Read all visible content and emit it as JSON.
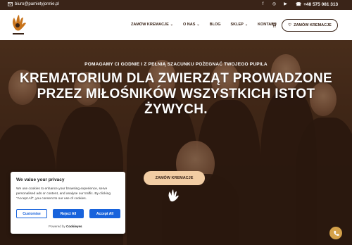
{
  "topbar": {
    "email": "biuro@pamietyjonnie.pl",
    "phone": "+48 575 081 313",
    "socials": [
      "facebook-icon",
      "instagram-icon",
      "youtube-icon"
    ]
  },
  "nav": {
    "items": [
      {
        "label": "ZAMÓW KREMACJE",
        "dropdown": true
      },
      {
        "label": "O NAS",
        "dropdown": true
      },
      {
        "label": "BLOG",
        "dropdown": false
      },
      {
        "label": "SKLEP",
        "dropdown": true
      },
      {
        "label": "KONTAKT",
        "dropdown": false
      }
    ],
    "cta": "ZAMÓW KREMACJE"
  },
  "hero": {
    "tagline": "POMAGAMY CI GODNIE I Z PEŁNIĄ SZACUNKU POŻEGNAĆ TWOJEGO PUPILA",
    "headline_line1": "KREMATORIUM DLA ZWIERZĄT PROWADZONE",
    "headline_line2": "PRZEZ MIŁOŚNIKÓW WSZYSTKICH ISTOT",
    "headline_line3": "ŻYWYCH.",
    "cta": "ZAMÓW KREMACJE"
  },
  "consent": {
    "title": "We value your privacy",
    "text": "We use cookies to enhance your browsing experience, serve personalised ads or content, and analyse our traffic. By clicking \"Accept All\", you consent to our use of cookies.",
    "customise": "Customise",
    "reject": "Reject All",
    "accept": "Accept All",
    "powered_prefix": "Powered by",
    "powered_brand": "Cookieyes"
  },
  "colors": {
    "brand_brown": "#3a2418",
    "accent_peach": "#f2cda4",
    "consent_blue": "#1863dc",
    "fab_gold": "#d4a14a"
  }
}
